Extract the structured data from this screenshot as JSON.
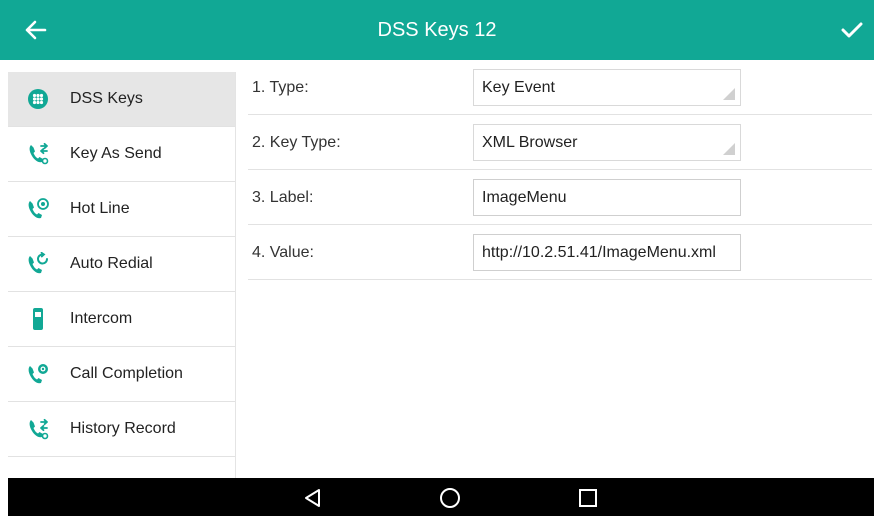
{
  "header": {
    "title": "DSS Keys 12",
    "accent_color": "#11a895",
    "back_icon": "arrow-left-icon",
    "save_icon": "checkmark-icon"
  },
  "sidebar": {
    "items": [
      {
        "label": "DSS Keys",
        "icon": "grid-dots-icon",
        "active": true
      },
      {
        "label": "Key As Send",
        "icon": "phone-arrows-icon",
        "active": false
      },
      {
        "label": "Hot Line",
        "icon": "phone-target-icon",
        "active": false
      },
      {
        "label": "Auto Redial",
        "icon": "phone-redial-icon",
        "active": false
      },
      {
        "label": "Intercom",
        "icon": "handset-icon",
        "active": false
      },
      {
        "label": "Call Completion",
        "icon": "phone-check-icon",
        "active": false
      },
      {
        "label": "History Record",
        "icon": "phone-history-icon",
        "active": false
      }
    ]
  },
  "form": {
    "fields": [
      {
        "label": "1. Type:",
        "value": "Key Event",
        "kind": "select"
      },
      {
        "label": "2. Key Type:",
        "value": "XML Browser",
        "kind": "select"
      },
      {
        "label": "3. Label:",
        "value": "ImageMenu",
        "kind": "text"
      },
      {
        "label": "4. Value:",
        "value": "http://10.2.51.41/ImageMenu.xml",
        "kind": "text"
      }
    ]
  },
  "navbar": {
    "back_icon": "nav-back-triangle-icon",
    "home_icon": "nav-home-circle-icon",
    "recents_icon": "nav-recents-square-icon"
  }
}
